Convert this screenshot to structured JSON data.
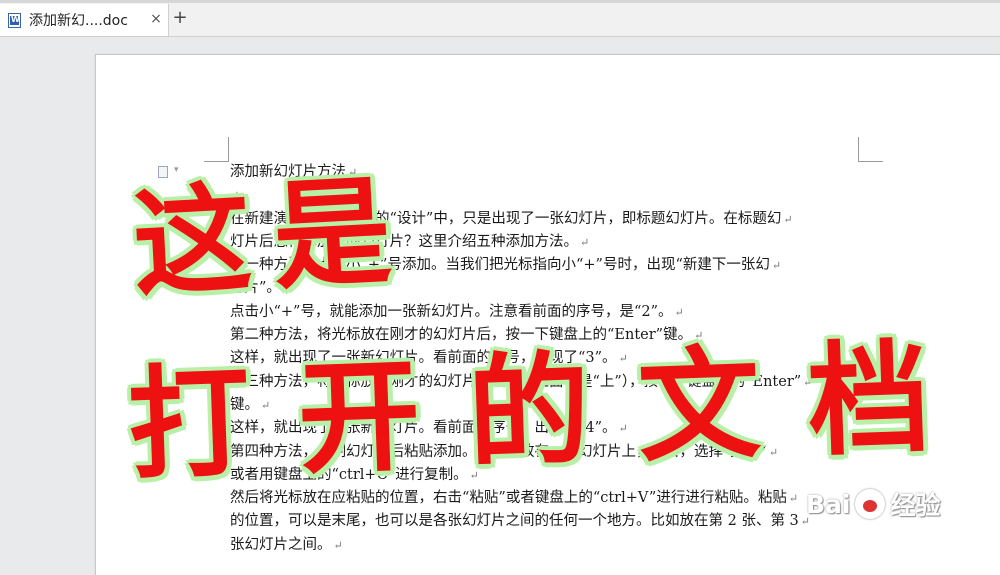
{
  "tab": {
    "title": "添加新幻....doc",
    "close": "×",
    "add": "+"
  },
  "doc": {
    "lines": [
      "添加新幻灯片方法",
      "",
      "在新建演示文稿或刚才的“设计”中，只是出现了一张幻灯片，即标题幻灯片。在标题幻",
      "灯片后怎样添加新的幻灯片？这里介绍五种添加方法。",
      "第一种方法，点击小“+”号添加。当我们把光标指向小“+”号时，出现“新建下一张幻",
      "灯片”。",
      "点击小“+”号，就能添加一张新幻灯片。注意看前面的序号，是“2”。",
      "第二种方法，将光标放在刚才的幻灯片后，按一下键盘上的“Enter”键。",
      "这样，就出现了一张新幻灯片。看前面的序号，出现了“3”。",
      "第三种方法，将光标放在刚才的幻灯片上（不是上面，是“上”），按一下键盘上的“Enter”",
      "键。",
      "这样，就出现了一张新幻灯片。看前面的序号，出现了“4”。",
      "第四种方法，复制幻灯片后粘贴添加。将光标放在一张幻灯片上，右击，选择“复制”",
      "或者用键盘上的“ctrl+C”进行复制。",
      "然后将光标放在应粘贴的位置，右击“粘贴”或者键盘上的“ctrl+V”进行进行粘贴。粘贴",
      "的位置，可以是末尾，也可以是各张幻灯片之间的任何一个地方。比如放在第 2 张、第 3",
      "张幻灯片之间。"
    ],
    "para_mark": "↵"
  },
  "overlay": {
    "line1": "这是",
    "line2": "打开的文档"
  },
  "watermark": {
    "brand": "Bai",
    "cn": "经验"
  },
  "colors": {
    "overlay": "#ee1111",
    "overlay_glow": "#b9f0a8",
    "page": "#ffffff",
    "chrome": "#e8eaec"
  }
}
